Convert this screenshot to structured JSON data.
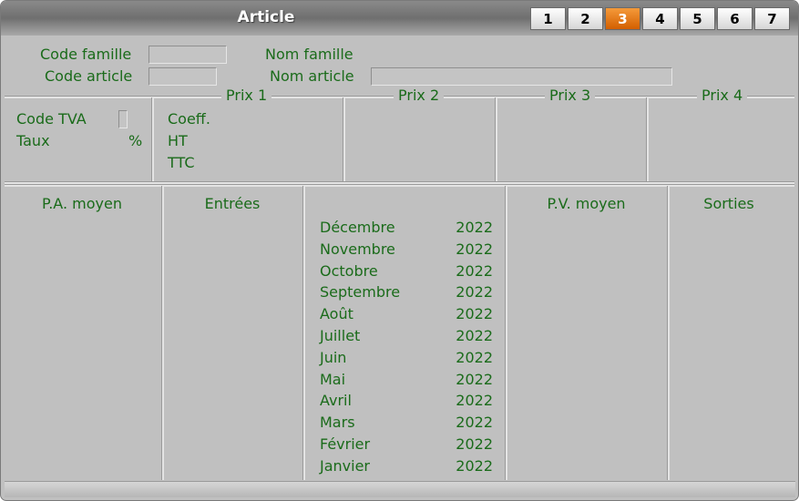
{
  "window": {
    "title": "Article"
  },
  "tabs": [
    {
      "label": "1",
      "active": false
    },
    {
      "label": "2",
      "active": false
    },
    {
      "label": "3",
      "active": true
    },
    {
      "label": "4",
      "active": false
    },
    {
      "label": "5",
      "active": false
    },
    {
      "label": "6",
      "active": false
    },
    {
      "label": "7",
      "active": false
    }
  ],
  "header": {
    "code_famille": "Code famille",
    "code_article": "Code article",
    "nom_famille": "Nom famille",
    "nom_article": "Nom article"
  },
  "prices": {
    "prix1": "Prix 1",
    "prix2": "Prix 2",
    "prix3": "Prix 3",
    "prix4": "Prix 4",
    "code_tva": "Code TVA",
    "taux": "Taux",
    "percent": "%",
    "coeff": "Coeff.",
    "ht": "HT",
    "ttc": "TTC"
  },
  "stats": {
    "pa_moyen": "P.A. moyen",
    "entrees": "Entrées",
    "pv_moyen": "P.V. moyen",
    "sorties": "Sorties",
    "months": [
      {
        "month": "Décembre",
        "year": "2022"
      },
      {
        "month": "Novembre",
        "year": "2022"
      },
      {
        "month": "Octobre",
        "year": "2022"
      },
      {
        "month": "Septembre",
        "year": "2022"
      },
      {
        "month": "Août",
        "year": "2022"
      },
      {
        "month": "Juillet",
        "year": "2022"
      },
      {
        "month": "Juin",
        "year": "2022"
      },
      {
        "month": "Mai",
        "year": "2022"
      },
      {
        "month": "Avril",
        "year": "2022"
      },
      {
        "month": "Mars",
        "year": "2022"
      },
      {
        "month": "Février",
        "year": "2022"
      },
      {
        "month": "Janvier",
        "year": "2022"
      }
    ]
  },
  "colors": {
    "label": "#1a6b1a",
    "active_tab": "#e8760d"
  }
}
